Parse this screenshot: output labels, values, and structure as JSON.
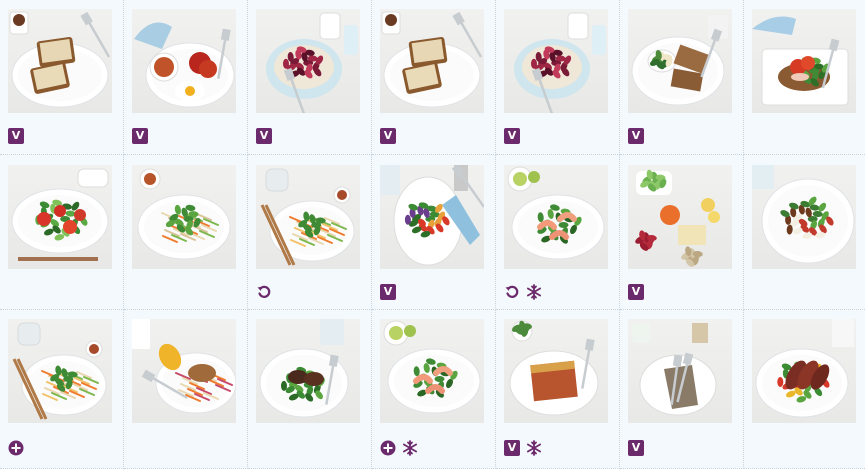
{
  "colors": {
    "badge": "#6b2a6b",
    "grid_line": "#c9d3dc",
    "cell_bg": "#f4f9fd"
  },
  "legend": {
    "v": "V"
  },
  "cells": [
    {
      "dish": "toast-with-tea",
      "badges": [
        "v"
      ]
    },
    {
      "dish": "beans-egg-tomato",
      "badges": [
        "v"
      ]
    },
    {
      "dish": "porridge-berries",
      "badges": [
        "v"
      ]
    },
    {
      "dish": "toast-with-tea",
      "badges": [
        "v"
      ]
    },
    {
      "dish": "porridge-berries",
      "badges": [
        "v"
      ]
    },
    {
      "dish": "toast-spinach-salad",
      "badges": [
        "v"
      ]
    },
    {
      "dish": "open-sandwich",
      "badges": []
    },
    {
      "dish": "tomato-salad",
      "badges": []
    },
    {
      "dish": "noodle-salad",
      "badges": []
    },
    {
      "dish": "slaw-bowl",
      "badges": [
        "repeat"
      ]
    },
    {
      "dish": "roast-veg-salad",
      "badges": [
        "v"
      ]
    },
    {
      "dish": "prawn-snowpea-salad",
      "badges": [
        "repeat",
        "freeze"
      ]
    },
    {
      "dish": "snack-platter",
      "badges": [
        "v"
      ]
    },
    {
      "dish": "bean-salad",
      "badges": []
    },
    {
      "dish": "slaw-bowl",
      "badges": [
        "add"
      ]
    },
    {
      "dish": "corn-chicken",
      "badges": []
    },
    {
      "dish": "steak-greens",
      "badges": []
    },
    {
      "dish": "prawn-snowpea-salad",
      "badges": [
        "add",
        "freeze"
      ]
    },
    {
      "dish": "lasagne",
      "badges": [
        "v",
        "freeze"
      ]
    },
    {
      "dish": "cutlery-napkin",
      "badges": [
        "v"
      ]
    },
    {
      "dish": "sliced-beef-salad",
      "badges": []
    }
  ]
}
